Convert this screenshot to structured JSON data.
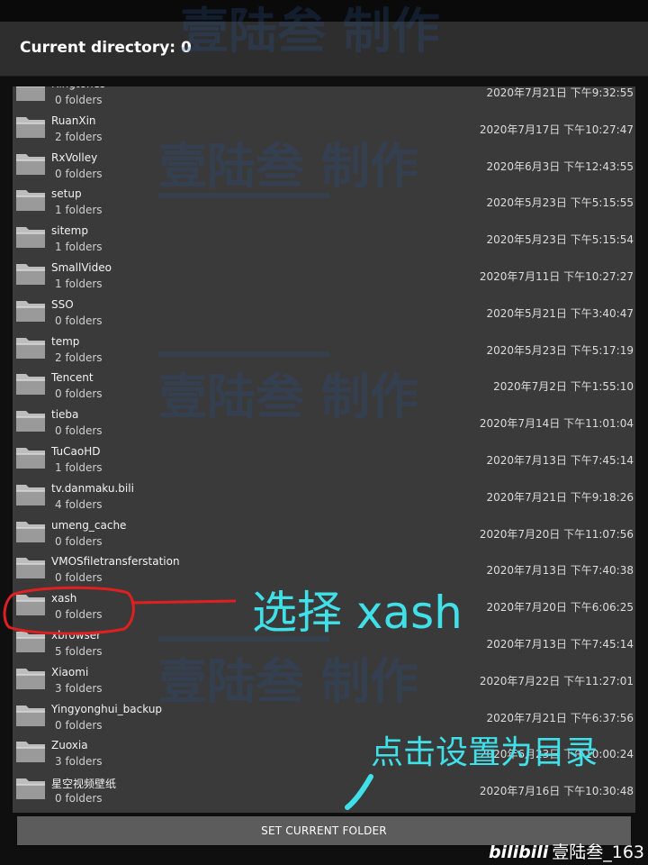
{
  "header": {
    "title": "Current directory: 0"
  },
  "folders": [
    {
      "name": "Ringtones",
      "sub": "0 folders",
      "date": "2020年7月21日 下午9:32:55"
    },
    {
      "name": "RuanXin",
      "sub": "2 folders",
      "date": "2020年7月17日 下午10:27:47"
    },
    {
      "name": "RxVolley",
      "sub": "0 folders",
      "date": "2020年6月3日 下午12:43:55"
    },
    {
      "name": "setup",
      "sub": "1 folders",
      "date": "2020年5月23日 下午5:15:55"
    },
    {
      "name": "sitemp",
      "sub": "1 folders",
      "date": "2020年5月23日 下午5:15:54"
    },
    {
      "name": "SmallVideo",
      "sub": "1 folders",
      "date": "2020年7月11日 下午10:27:27"
    },
    {
      "name": "SSO",
      "sub": "0 folders",
      "date": "2020年5月21日 下午3:40:47"
    },
    {
      "name": "temp",
      "sub": "2 folders",
      "date": "2020年5月23日 下午5:17:19"
    },
    {
      "name": "Tencent",
      "sub": "0 folders",
      "date": "2020年7月2日 下午1:55:10"
    },
    {
      "name": "tieba",
      "sub": "0 folders",
      "date": "2020年7月14日 下午11:01:04"
    },
    {
      "name": "TuCaoHD",
      "sub": "1 folders",
      "date": "2020年7月13日 下午7:45:14"
    },
    {
      "name": "tv.danmaku.bili",
      "sub": "4 folders",
      "date": "2020年7月21日 下午9:18:26"
    },
    {
      "name": "umeng_cache",
      "sub": "0 folders",
      "date": "2020年7月20日 下午11:07:56"
    },
    {
      "name": "VMOSfiletransferstation",
      "sub": "0 folders",
      "date": "2020年7月13日 下午7:40:38"
    },
    {
      "name": "xash",
      "sub": "0 folders",
      "date": "2020年7月20日 下午6:06:25"
    },
    {
      "name": "xbrowser",
      "sub": "5 folders",
      "date": "2020年7月13日 下午7:45:14"
    },
    {
      "name": "Xiaomi",
      "sub": "3 folders",
      "date": "2020年7月22日 下午11:27:01"
    },
    {
      "name": "Yingyonghui_backup",
      "sub": "0 folders",
      "date": "2020年7月21日 下午6:37:56"
    },
    {
      "name": "Zuoxia",
      "sub": "3 folders",
      "date": "2020年6月23日 下午10:00:24"
    },
    {
      "name": "星空视频壁纸",
      "sub": "0 folders",
      "date": "2020年7月16日 下午10:30:48"
    }
  ],
  "buttons": {
    "set_current_folder": "SET CURRENT FOLDER"
  },
  "watermark": {
    "text": "壹陆叁  制作"
  },
  "annotations": {
    "select_xash": "选择 xash",
    "click_set": "点击设置为目录"
  },
  "credit": {
    "logo": "bilibili",
    "user": "壹陆叁_163"
  },
  "icons": {
    "folder": "folder-icon"
  },
  "colors": {
    "annotation": "#3fe0e8",
    "highlight": "#e02020",
    "button": "#5c5c5c"
  }
}
